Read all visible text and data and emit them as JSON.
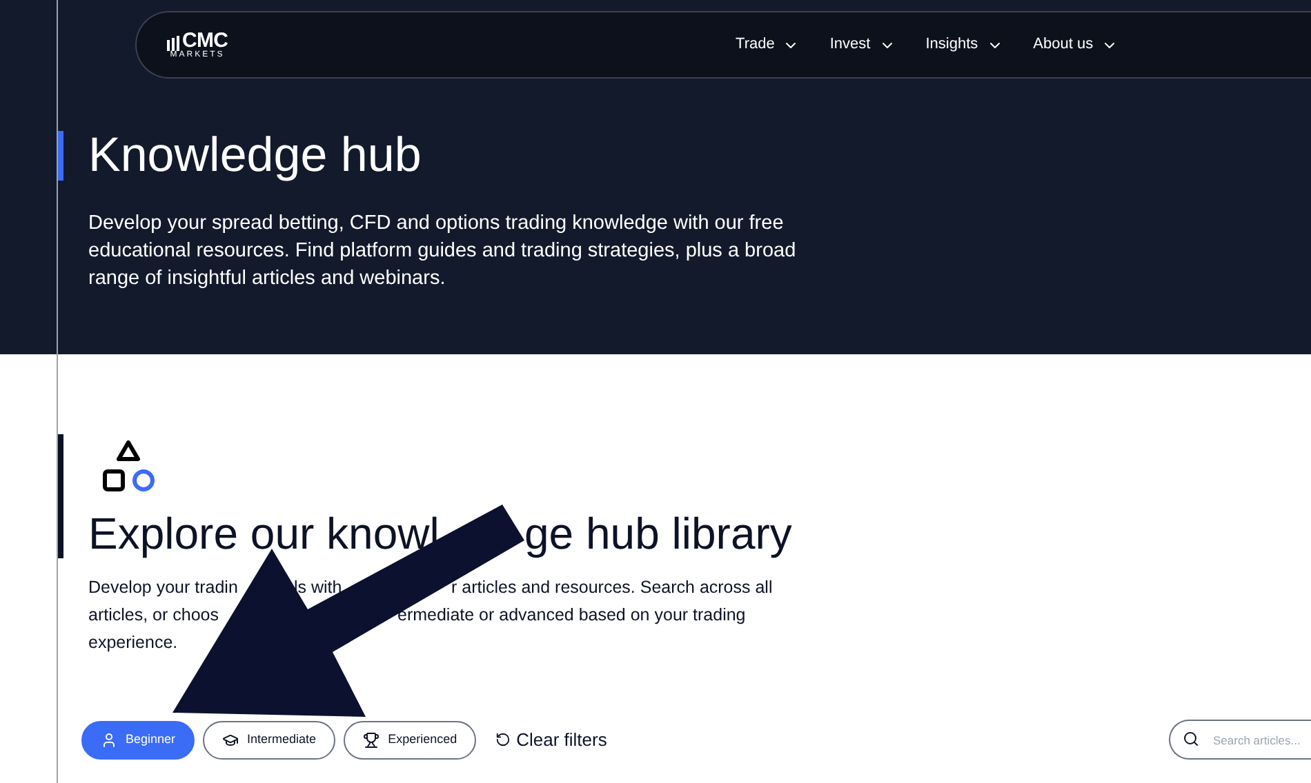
{
  "header": {
    "logo": {
      "brand": "CMC",
      "sub": "MARKETS"
    },
    "nav": [
      {
        "label": "Trade"
      },
      {
        "label": "Invest"
      },
      {
        "label": "Insights"
      },
      {
        "label": "About us"
      }
    ]
  },
  "hero": {
    "title": "Knowledge hub",
    "text": "Develop your spread betting, CFD and options trading knowledge with our free educational resources. Find platform guides and trading strategies, plus a broad range of insightful articles and webinars."
  },
  "library": {
    "title_parts": [
      "Explore our knowl",
      "ge hub library"
    ],
    "text_lines": [
      [
        "Develop your tradin",
        "ls with",
        "r articles and resources. Search across all"
      ],
      [
        "articles, or choos",
        "ermediate or advanced based on your trading"
      ],
      [
        "experience."
      ]
    ],
    "filters": [
      {
        "label": "Beginner",
        "kind": "beginner",
        "selected": true
      },
      {
        "label": "Intermediate",
        "kind": "intermediate",
        "selected": false
      },
      {
        "label": "Experienced",
        "kind": "experienced",
        "selected": false
      }
    ],
    "clear": "Clear filters",
    "search": {
      "placeholder": "Search articles..."
    }
  }
}
